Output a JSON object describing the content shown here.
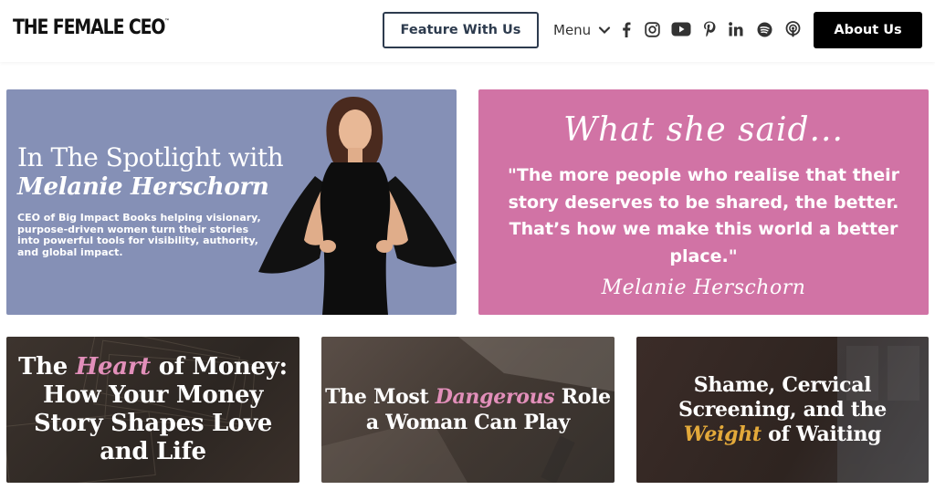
{
  "header": {
    "logo": "THE FEMALE CEO",
    "logo_tm": "™",
    "feature_label": "Feature With Us",
    "menu_label": "Menu",
    "about_label": "About Us",
    "social_icons": [
      "facebook-icon",
      "instagram-icon",
      "youtube-icon",
      "pinterest-icon",
      "linkedin-icon",
      "spotify-icon",
      "podcast-icon"
    ]
  },
  "spotlight": {
    "title": "In The Spotlight with",
    "name": "Melanie Herschorn",
    "description": "CEO of Big Impact Books helping visionary, purpose-driven women turn their stories into powerful tools for visibility, authority, and global impact."
  },
  "quote": {
    "heading": "What she said...",
    "text": "\"The more people who realise that their story deserves to be shared, the better. That’s how we make this world a better place.\"",
    "signature": "Melanie Herschorn"
  },
  "articles": [
    {
      "pre": "The ",
      "accent": "Heart",
      "post": " of Money: How Your Money Story Shapes Love and Life"
    },
    {
      "pre": "The Most ",
      "accent": "Dangerous",
      "post": " Role a Woman Can Play"
    },
    {
      "pre": "Shame, Cervical Screening, and the ",
      "accent": "Weight",
      "post": " of Waiting"
    }
  ],
  "colors": {
    "spotlight_bg": "#8590b6",
    "quote_bg": "#d173a5",
    "accent_pink": "#e28fba",
    "accent_gold": "#e3a93a"
  }
}
